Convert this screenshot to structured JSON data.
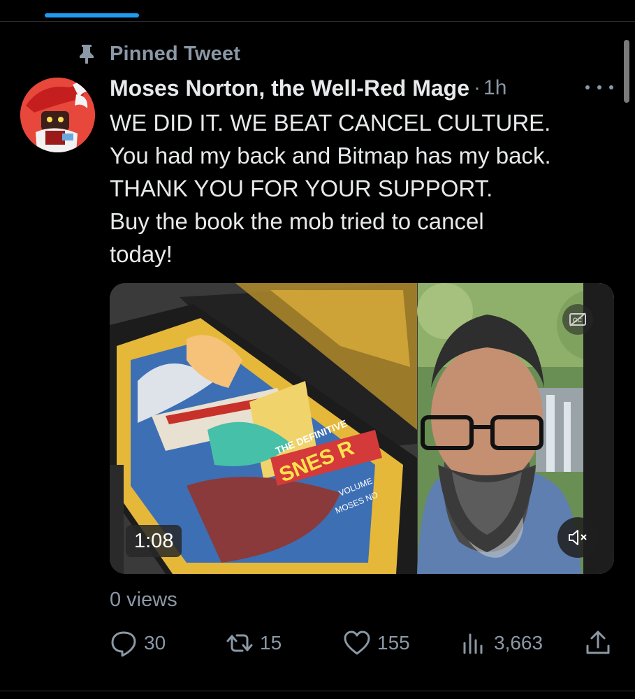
{
  "pinned_label": "Pinned Tweet",
  "tweet": {
    "author": "Moses Norton, the Well-Red Mage",
    "separator": "·",
    "time": "1h",
    "text_lines": [
      "WE DID IT. WE BEAT CANCEL CULTURE.",
      "You had my back and Bitmap has my back.",
      "THANK YOU FOR YOUR SUPPORT.",
      "Buy the book the mob tried to cancel",
      "today!"
    ]
  },
  "media": {
    "duration": "1:08",
    "book_cover_text": [
      "THE DEFINITIVE",
      "SNES R",
      "VOLUME",
      "MOSES NO"
    ],
    "controls": {
      "captions_icon": "cc-off-icon",
      "mute_icon": "muted-speaker-icon"
    }
  },
  "views": "0 views",
  "actions": {
    "replies": "30",
    "retweets": "15",
    "likes": "155",
    "analytics": "3,663"
  },
  "colors": {
    "background": "#000000",
    "text": "#e7e9ea",
    "secondary": "#8b98a5",
    "accent": "#1d9bf0",
    "divider": "#2f3336"
  }
}
